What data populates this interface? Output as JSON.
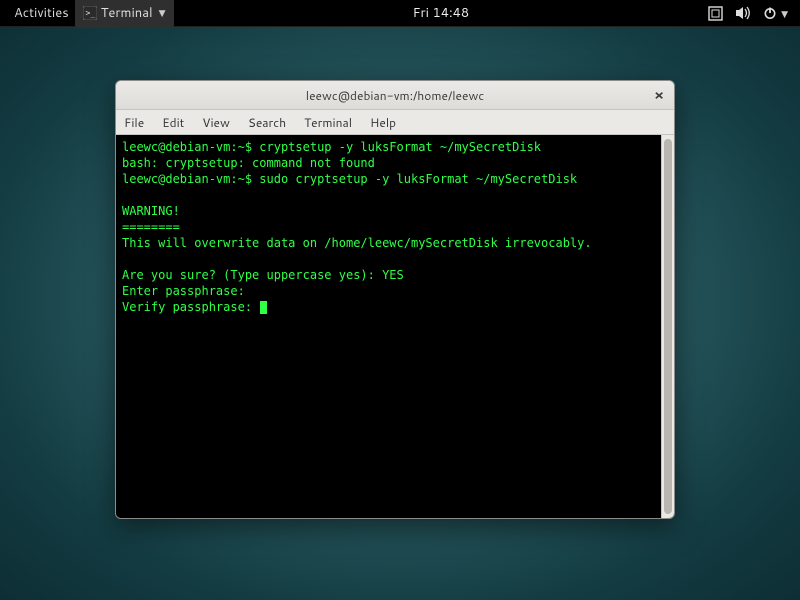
{
  "topbar": {
    "activities": "Activities",
    "app_name": "Terminal",
    "clock": "Fri 14:48"
  },
  "window": {
    "title": "leewc@debian-vm:/home/leewc"
  },
  "menubar": {
    "file": "File",
    "edit": "Edit",
    "view": "View",
    "search": "Search",
    "terminal": "Terminal",
    "help": "Help"
  },
  "terminal_lines": [
    "leewc@debian-vm:~$ cryptsetup -y luksFormat ~/mySecretDisk",
    "bash: cryptsetup: command not found",
    "leewc@debian-vm:~$ sudo cryptsetup -y luksFormat ~/mySecretDisk",
    "",
    "WARNING!",
    "========",
    "This will overwrite data on /home/leewc/mySecretDisk irrevocably.",
    "",
    "Are you sure? (Type uppercase yes): YES",
    "Enter passphrase: ",
    "Verify passphrase: "
  ]
}
